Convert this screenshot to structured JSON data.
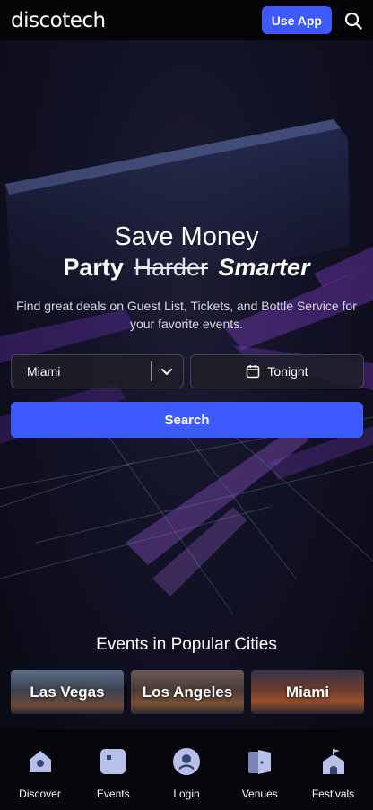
{
  "header": {
    "logo": "discotech",
    "use_app_label": "Use App",
    "search_icon": "search-icon"
  },
  "hero": {
    "line1": "Save Money",
    "line2_prefix": "Party",
    "line2_strike": "Harder",
    "line2_emphasis": "Smarter",
    "subtitle": "Find great deals on Guest List, Tickets, and Bottle Service for your favorite events.",
    "city_select": {
      "value": "Miami",
      "icon": "chevron-down-icon"
    },
    "date_select": {
      "value": "Tonight",
      "icon": "calendar-icon"
    },
    "search_label": "Search"
  },
  "popular": {
    "title": "Events in Popular Cities",
    "cities": [
      {
        "label": "Las Vegas"
      },
      {
        "label": "Los Angeles"
      },
      {
        "label": "Miami"
      }
    ]
  },
  "bottom_nav": [
    {
      "label": "Discover",
      "icon": "discover-icon"
    },
    {
      "label": "Events",
      "icon": "events-icon"
    },
    {
      "label": "Login",
      "icon": "login-icon"
    },
    {
      "label": "Venues",
      "icon": "venues-icon"
    },
    {
      "label": "Festivals",
      "icon": "festivals-icon"
    }
  ],
  "colors": {
    "accent": "#3d5afe",
    "background": "#0b0b12",
    "nav_icon": "#b7c0e8"
  }
}
